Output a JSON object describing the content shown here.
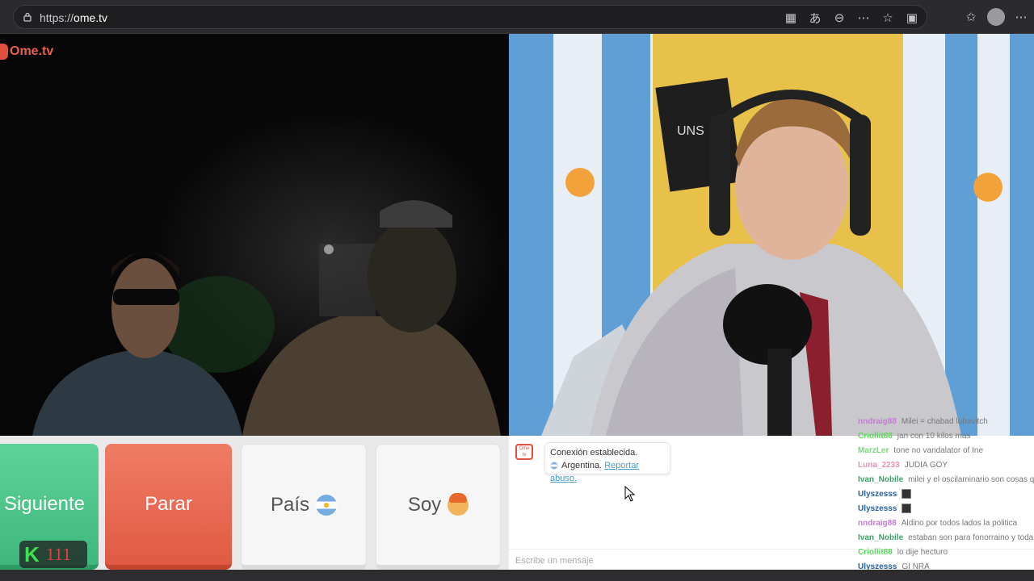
{
  "browser": {
    "url_prefix": "https://",
    "url_host": "ome.tv",
    "toolbar_icons": [
      "apps-icon",
      "translate-icon",
      "zoom-out-icon",
      "more-icon",
      "favorite-star-icon",
      "camera-icon",
      "favorites-icon",
      "profile-avatar",
      "menu-icon"
    ]
  },
  "app": {
    "logo_text": "Ome.tv"
  },
  "controls": {
    "next_label": "Siguiente",
    "stop_label": "Parar",
    "country_label": "País",
    "gender_label": "Soy"
  },
  "badge": {
    "letter": "K",
    "count": "111"
  },
  "chat": {
    "system_icon_text": "Ome tv",
    "connection_text": "Conexión establecida.",
    "country": "Argentina.",
    "report_link": "Reportar abuso.",
    "input_placeholder": "Escribe un mensaje"
  },
  "overlay_chat": [
    {
      "user": "nndraig88",
      "color": "#c77ad8",
      "text": "Milei = chabad lubavitch"
    },
    {
      "user": "Criollit88",
      "color": "#5ad85a",
      "text": "jan con 10 kilos mas"
    },
    {
      "user": "MarzLer",
      "color": "#7ad87a",
      "text": "tone no vandalator of Ine"
    },
    {
      "user": "Luna_2233",
      "color": "#e890b8",
      "text": "JUDIA GOY"
    },
    {
      "user": "Ivan_Nobile",
      "color": "#3fa06a",
      "text": "milei y el oscilaminario son cosas que a"
    },
    {
      "user": "Ulyszesss",
      "color": "#2a5fa0",
      "text": ""
    },
    {
      "user": "Ulyszesss",
      "color": "#2a5fa0",
      "text": ""
    },
    {
      "user": "nndraig88",
      "color": "#c77ad8",
      "text": "Aldino por todos lados la politica"
    },
    {
      "user": "Ivan_Nobile",
      "color": "#3fa06a",
      "text": "estaban son para fonorraino y toda esa"
    },
    {
      "user": "Criollit88",
      "color": "#5ad85a",
      "text": "lo dije hecturo"
    },
    {
      "user": "Ulyszesss",
      "color": "#2a5fa0",
      "text": "GI NRA"
    }
  ],
  "colors": {
    "next": "#46c082",
    "stop": "#e8634d",
    "brand": "#e0503c"
  }
}
